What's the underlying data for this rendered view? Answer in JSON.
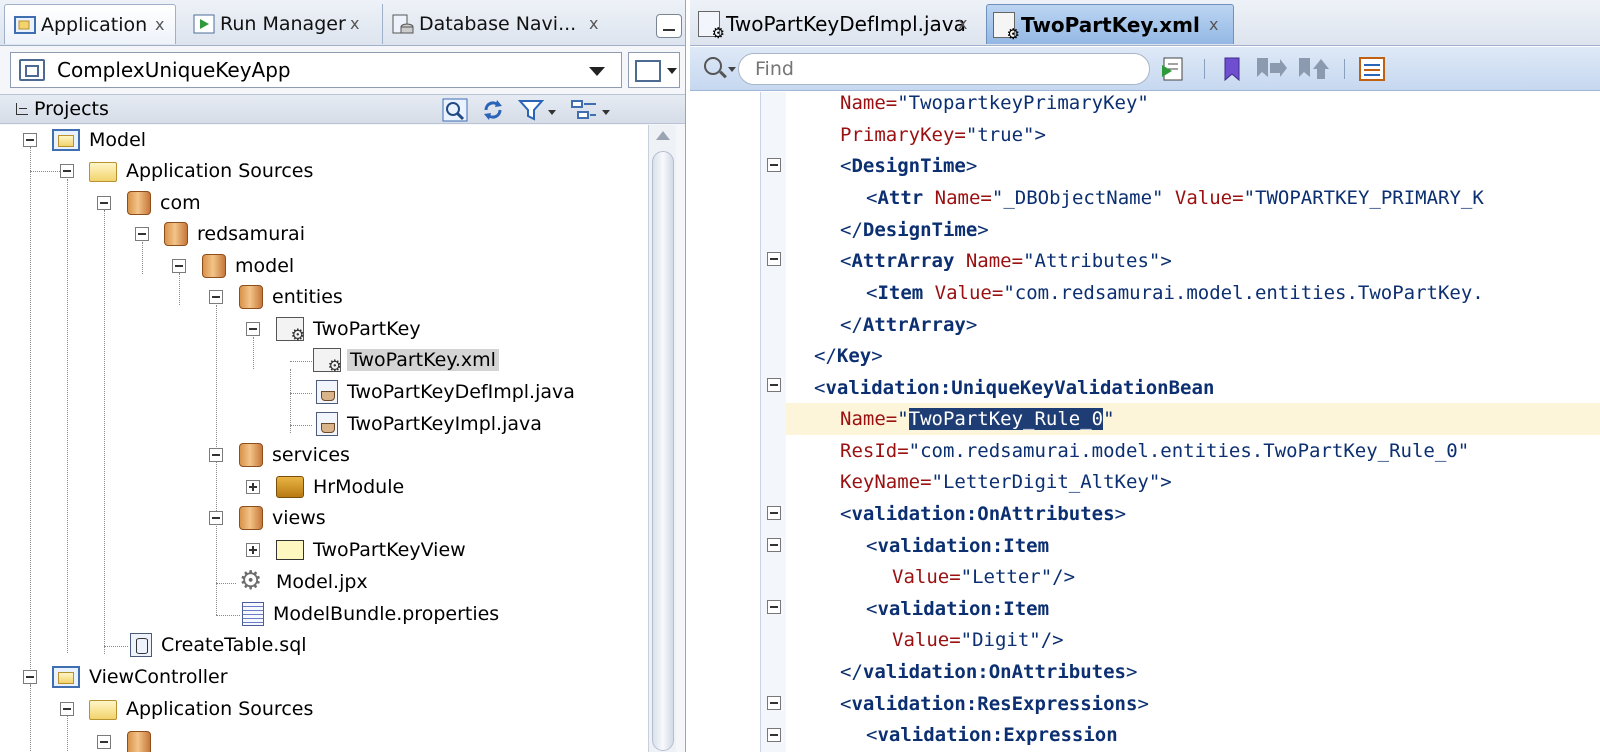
{
  "left_tabs": [
    {
      "label": "Application",
      "icon": "application-navigator-icon",
      "active": true
    },
    {
      "label": "Run Manager",
      "icon": "run-manager-icon",
      "active": false
    },
    {
      "label": "Database Navi...",
      "icon": "database-navigator-icon",
      "active": false
    }
  ],
  "app_selector": {
    "value": "ComplexUniqueKeyApp"
  },
  "projects_panel": {
    "title": "Projects"
  },
  "tree": [
    {
      "label": "Model"
    },
    {
      "label": "Application Sources"
    },
    {
      "label": "com"
    },
    {
      "label": "redsamurai"
    },
    {
      "label": "model"
    },
    {
      "label": "entities"
    },
    {
      "label": "TwoPartKey"
    },
    {
      "label": "TwoPartKey.xml"
    },
    {
      "label": "TwoPartKeyDefImpl.java"
    },
    {
      "label": "TwoPartKeyImpl.java"
    },
    {
      "label": "services"
    },
    {
      "label": "HrModule"
    },
    {
      "label": "views"
    },
    {
      "label": "TwoPartKeyView"
    },
    {
      "label": "Model.jpx"
    },
    {
      "label": "ModelBundle.properties"
    },
    {
      "label": "CreateTable.sql"
    },
    {
      "label": "ViewController"
    },
    {
      "label": "Application Sources"
    }
  ],
  "editor_tabs": [
    {
      "label": "TwoPartKeyDefImpl.java",
      "active": false
    },
    {
      "label": "TwoPartKey.xml",
      "active": true
    }
  ],
  "find": {
    "placeholder": "Find"
  },
  "code": {
    "l1_attr": "Name=",
    "l1_val": "\"TwopartkeyPrimaryKey\"",
    "l2_attr": "PrimaryKey=",
    "l2_val": "\"true\"",
    "l2_end": ">",
    "l3_open": "<",
    "l3_tag": "DesignTime",
    "l3_close": ">",
    "l4_open": "<",
    "l4_tag": "Attr",
    "l4_a1": "Name=",
    "l4_v1": "\"_DBObjectName\"",
    "l4_a2": "Value=",
    "l4_v2": "\"TWOPARTKEY_PRIMARY_K",
    "l5_open": "</",
    "l5_tag": "DesignTime",
    "l5_close": ">",
    "l6_open": "<",
    "l6_tag": "AttrArray",
    "l6_a1": "Name=",
    "l6_v1": "\"Attributes\"",
    "l6_close": ">",
    "l7_open": "<",
    "l7_tag": "Item",
    "l7_a1": "Value=",
    "l7_v1": "\"com.redsamurai.model.entities.TwoPartKey.",
    "l8_open": "</",
    "l8_tag": "AttrArray",
    "l8_close": ">",
    "l9_open": "</",
    "l9_tag": "Key",
    "l9_close": ">",
    "l10_open": "<",
    "l10_tag": "validation:UniqueKeyValidationBean",
    "l11_attr": "Name=",
    "l11_q1": "\"",
    "l11_sel": "TwoPartKey_Rule_0",
    "l11_q2": "\"",
    "l12_attr": "ResId=",
    "l12_val": "\"com.redsamurai.model.entities.TwoPartKey_Rule_0\"",
    "l13_attr": "KeyName=",
    "l13_val": "\"LetterDigit_AltKey\"",
    "l13_close": ">",
    "l14_open": "<",
    "l14_tag": "validation:OnAttributes",
    "l14_close": ">",
    "l15_open": "<",
    "l15_tag": "validation:Item",
    "l16_attr": "Value=",
    "l16_val": "\"Letter\"",
    "l16_close": "/>",
    "l17_open": "<",
    "l17_tag": "validation:Item",
    "l18_attr": "Value=",
    "l18_val": "\"Digit\"",
    "l18_close": "/>",
    "l19_open": "</",
    "l19_tag": "validation:OnAttributes",
    "l19_close": ">",
    "l20_open": "<",
    "l20_tag": "validation:ResExpressions",
    "l20_close": ">",
    "l21_open": "<",
    "l21_tag": "validation:Expression"
  },
  "colors": {
    "xml_tag": "#0b2f70",
    "xml_attr": "#9a1010",
    "selection": "#1f3d75",
    "current_line": "#fdf5d9"
  }
}
